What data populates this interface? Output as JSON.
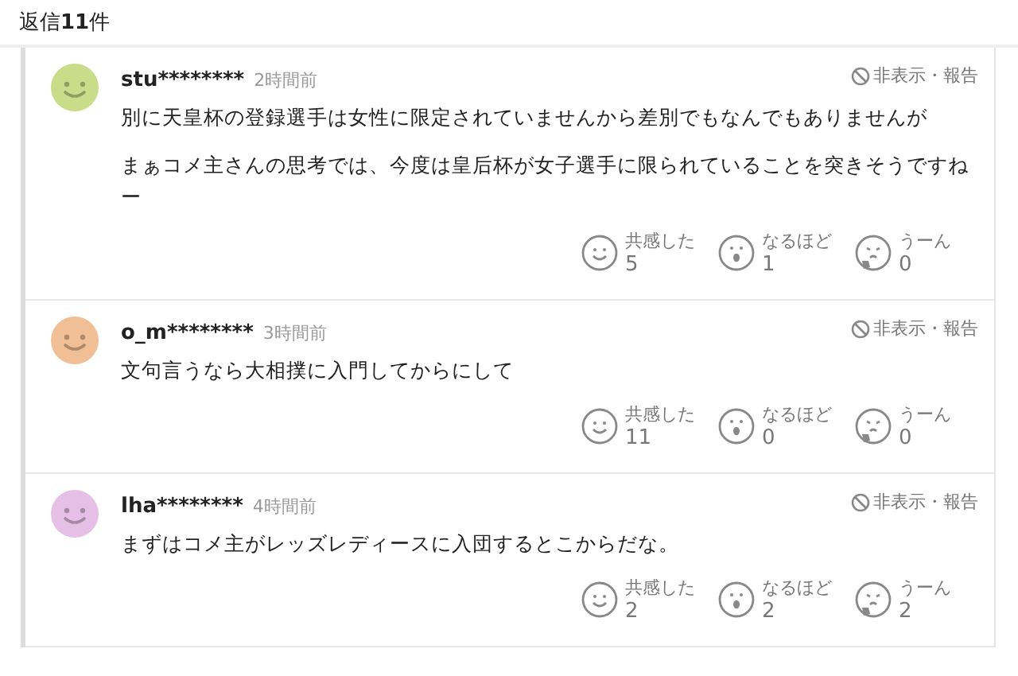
{
  "reply_count": "返信**11**件",
  "comments": [
    {
      "user": "stu********",
      "time": "2時間前",
      "color": "#c9dc8a",
      "hide_link": "非表示・報告",
      "paragraphs": [
        "別に天皇杯の登録選手は女性に限定されていませんから差別でもなんでもありませんが",
        "まぁコメ主さんの思考では、今度は皇后杯が女子選手に限られていることを突きそうですねー"
      ],
      "reactions": [
        {
          "kind": "empathy",
          "label": "共感した",
          "count": "5"
        },
        {
          "kind": "insight",
          "label": "なるほど",
          "count": "1"
        },
        {
          "kind": "doubt",
          "label": "うーん",
          "count": "0"
        }
      ]
    },
    {
      "user": "o_m********",
      "time": "3時間前",
      "color": "#f0bf95",
      "hide_link": "非表示・報告",
      "paragraphs": [
        "文句言うなら大相撲に入門してからにして"
      ],
      "reactions": [
        {
          "kind": "empathy",
          "label": "共感した",
          "count": "11"
        },
        {
          "kind": "insight",
          "label": "なるほど",
          "count": "0"
        },
        {
          "kind": "doubt",
          "label": "うーん",
          "count": "0"
        }
      ]
    },
    {
      "user": "lha********",
      "time": "4時間前",
      "color": "#e5bfe6",
      "hide_link": "非表示・報告",
      "paragraphs": [
        "まずはコメ主がレッズレディースに入団するとこからだな。"
      ],
      "reactions": [
        {
          "kind": "empathy",
          "label": "共感した",
          "count": "2"
        },
        {
          "kind": "insight",
          "label": "なるほど",
          "count": "2"
        },
        {
          "kind": "doubt",
          "label": "うーん",
          "count": "2"
        }
      ]
    }
  ]
}
